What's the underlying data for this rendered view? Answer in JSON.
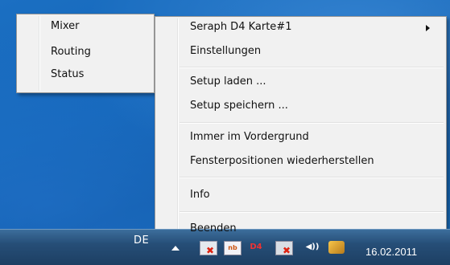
{
  "submenu": {
    "items": [
      {
        "label": "Mixer"
      },
      {
        "label": "Routing"
      },
      {
        "label": "Status"
      }
    ]
  },
  "context_menu": {
    "items": [
      {
        "label": "Seraph D4 Karte#1",
        "has_submenu": true,
        "highlighted": true
      },
      {
        "label": "Einstellungen"
      },
      {
        "label": "Setup laden ..."
      },
      {
        "label": "Setup speichern ..."
      },
      {
        "label": "Immer im Vordergrund"
      },
      {
        "label": "Fensterpositionen wiederherstellen"
      },
      {
        "label": "Info"
      },
      {
        "label": "Beenden"
      }
    ]
  },
  "taskbar": {
    "language": "DE",
    "tray_icons": [
      {
        "icon": "network-disconnected-icon"
      },
      {
        "icon": "audio-app-icon",
        "text": "nb"
      },
      {
        "icon": "d4-tray-icon",
        "text": "D4"
      },
      {
        "icon": "network-disconnected-icon-2"
      },
      {
        "icon": "volume-icon",
        "text": "◀))"
      },
      {
        "icon": "app-icon"
      }
    ],
    "clock": "16.02.2011"
  }
}
